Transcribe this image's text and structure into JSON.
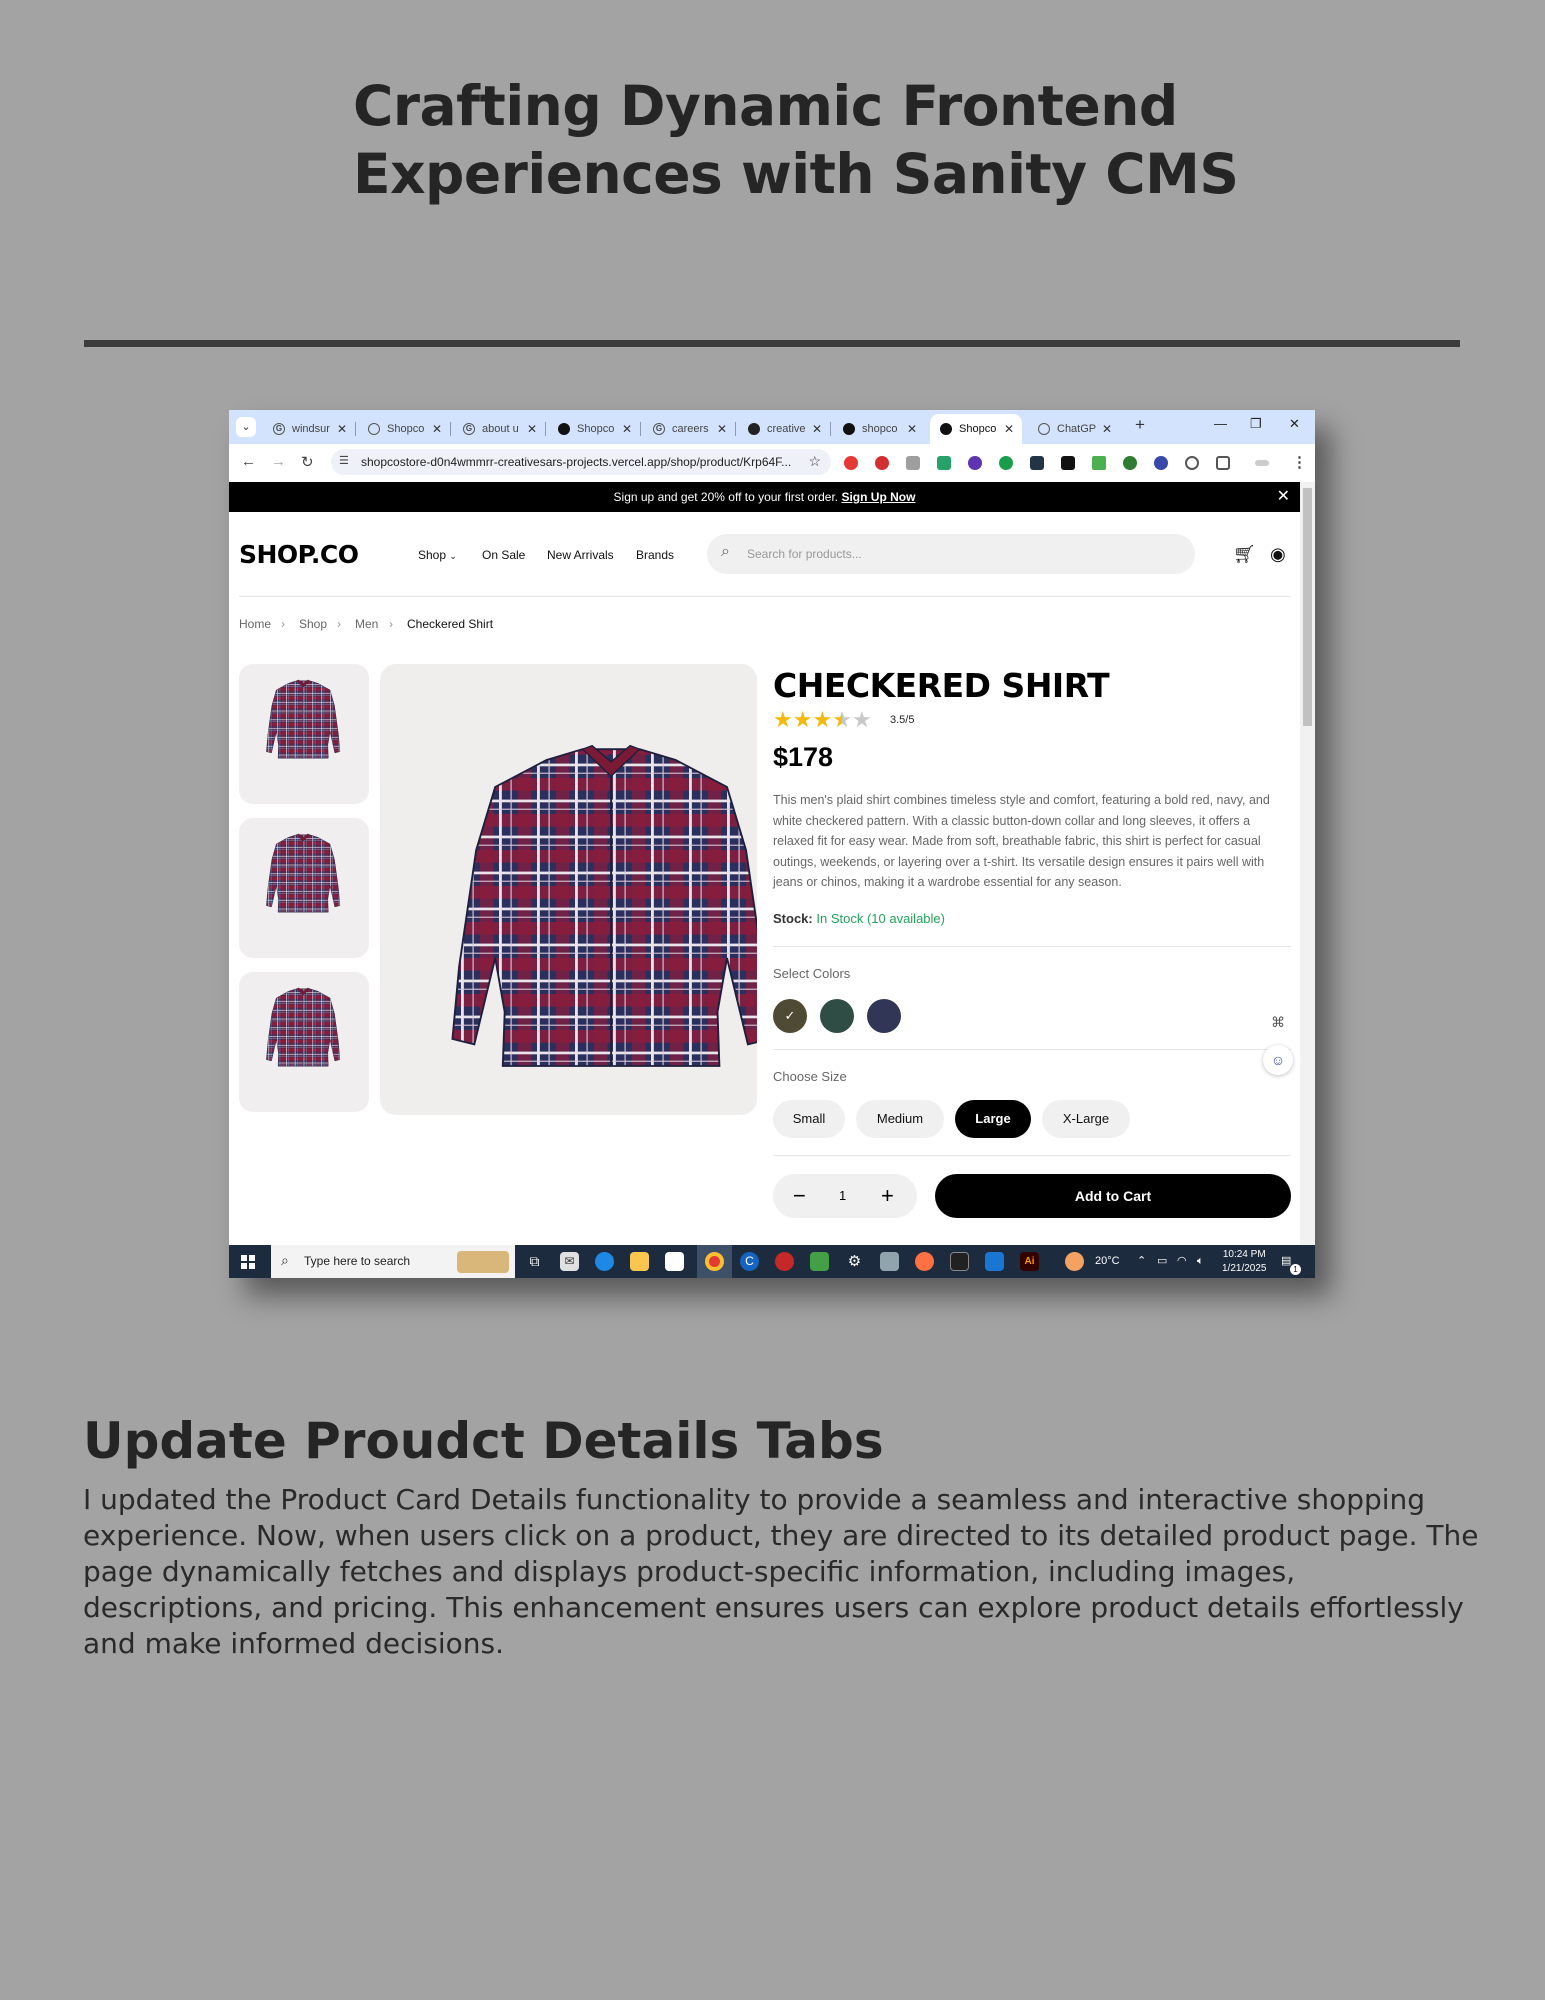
{
  "heading": {
    "title": "Crafting Dynamic Frontend Experiences with Sanity CMS"
  },
  "browser": {
    "tabs": [
      {
        "label": "windsur",
        "icon": "G"
      },
      {
        "label": "Shopco",
        "icon": "globe"
      },
      {
        "label": "about u",
        "icon": "G"
      },
      {
        "label": "Shopco",
        "icon": "A"
      },
      {
        "label": "careers",
        "icon": "G"
      },
      {
        "label": "creative",
        "icon": "github"
      },
      {
        "label": "shopco",
        "icon": "A"
      },
      {
        "label": "Shopco",
        "icon": "A"
      },
      {
        "label": "ChatGP",
        "icon": "openai"
      }
    ],
    "url": "shopcostore-d0n4wmmrr-creativesars-projects.vercel.app/shop/product/Krp64F..."
  },
  "site": {
    "promo": {
      "text": "Sign up and get 20% off to your first order.",
      "link": "Sign Up Now"
    },
    "logo": "SHOP.CO",
    "nav": {
      "shop": "Shop",
      "on_sale": "On Sale",
      "new_arrivals": "New Arrivals",
      "brands": "Brands"
    },
    "search_placeholder": "Search for products..."
  },
  "breadcrumb": [
    "Home",
    "Shop",
    "Men",
    "Checkered Shirt"
  ],
  "product": {
    "title": "CHECKERED SHIRT",
    "rating": 3.5,
    "rating_label": "3.5/5",
    "price": "$178",
    "description": "This men's plaid shirt combines timeless style and comfort, featuring a bold red, navy, and white checkered pattern. With a classic button-down collar and long sleeves, it offers a relaxed fit for easy wear. Made from soft, breathable fabric, this shirt is perfect for casual outings, weekends, or layering over a t-shirt. Its versatile design ensures it pairs well with jeans or chinos, making it a wardrobe essential for any season.",
    "stock_label": "Stock:",
    "stock_value": "In Stock (10 available)",
    "colors_label": "Select Colors",
    "colors": [
      "#4f4a34",
      "#2f4c45",
      "#313656"
    ],
    "size_label": "Choose Size",
    "sizes": [
      "Small",
      "Medium",
      "Large",
      "X-Large"
    ],
    "selected_size": "Large",
    "quantity": "1",
    "add_to_cart": "Add to Cart"
  },
  "taskbar": {
    "search": "Type here to search",
    "temperature": "20°C",
    "time": "10:24 PM",
    "date": "1/21/2025",
    "notifications": "1"
  },
  "section": {
    "title": "Update Proudct Details Tabs",
    "body": "I updated the Product Card Details functionality to provide a seamless and interactive shopping experience. Now, when users click on a product, they are directed to its detailed product page. The page dynamically fetches and displays product-specific information, including images, descriptions, and pricing. This enhancement ensures users can explore product details effortlessly and make informed decisions."
  },
  "colors": {
    "background": "#a3a3a3",
    "accent": "#000000",
    "stock_green": "#22a35a",
    "star": "#f5b80c"
  }
}
